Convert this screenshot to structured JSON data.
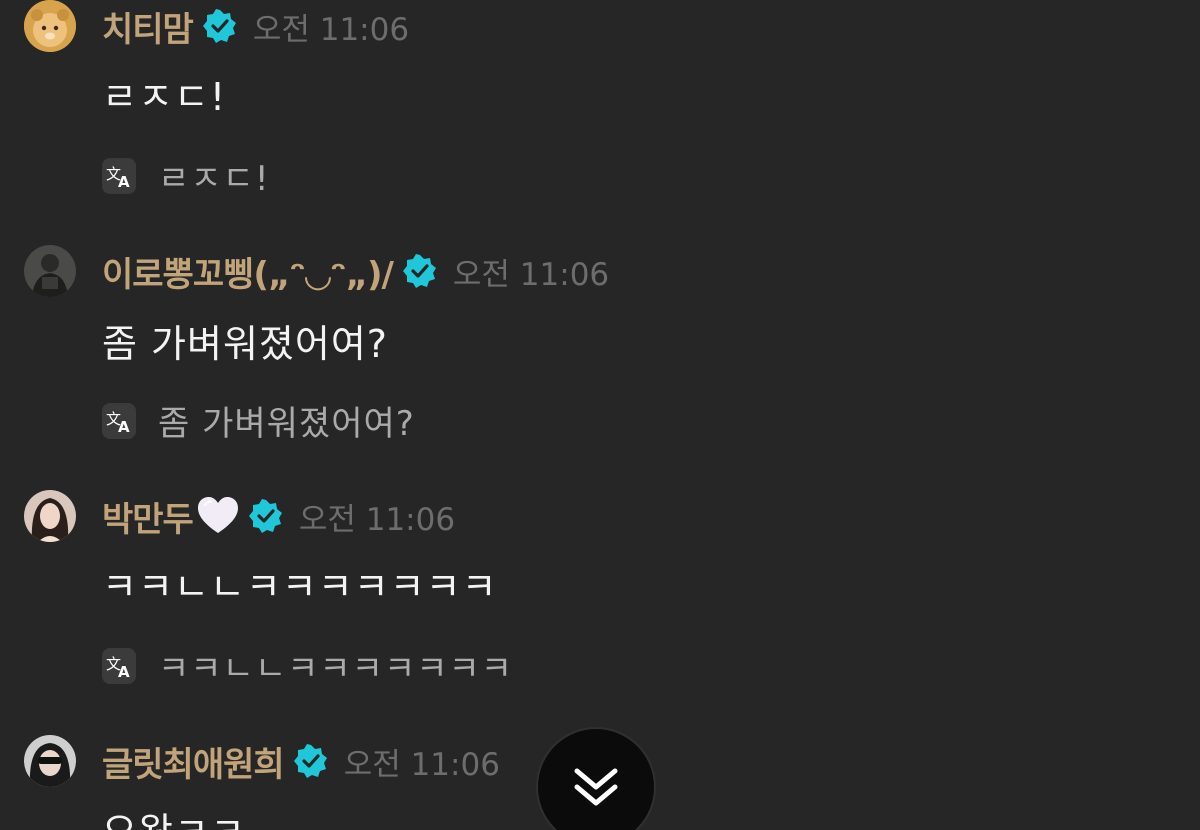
{
  "messages": [
    {
      "username": "치티맘",
      "heart": false,
      "time": "오전 11:06",
      "text": "ㄹㅈㄷ!",
      "translation": "ㄹㅈㄷ!"
    },
    {
      "username": "이로뽕꼬삥(„ᵔ◡ᵔ„)/",
      "heart": false,
      "time": "오전 11:06",
      "text": "좀 가벼워졌어여?",
      "translation": "좀 가벼워졌어여?"
    },
    {
      "username": "박만두",
      "heart": true,
      "time": "오전 11:06",
      "text": "ㅋㅋㄴㄴㅋㅋㅋㅋㅋㅋㅋ",
      "translation": "ㅋㅋㄴㄴㅋㅋㅋㅋㅋㅋㅋ"
    },
    {
      "username": "글릿최애원희",
      "heart": false,
      "time": "오전 11:06",
      "text": "으왕ㅋㅋ",
      "translation": ""
    }
  ],
  "icons": {
    "verified": "verified-badge-icon",
    "translate": "translate-icon",
    "scroll": "double-chevron-down-icon"
  },
  "colors": {
    "background": "#262626",
    "username": "#c2a47a",
    "verified": "#1fc7d9",
    "time": "#6d6d6d",
    "message": "#f3f3f3",
    "translation": "#aaaaaa"
  }
}
